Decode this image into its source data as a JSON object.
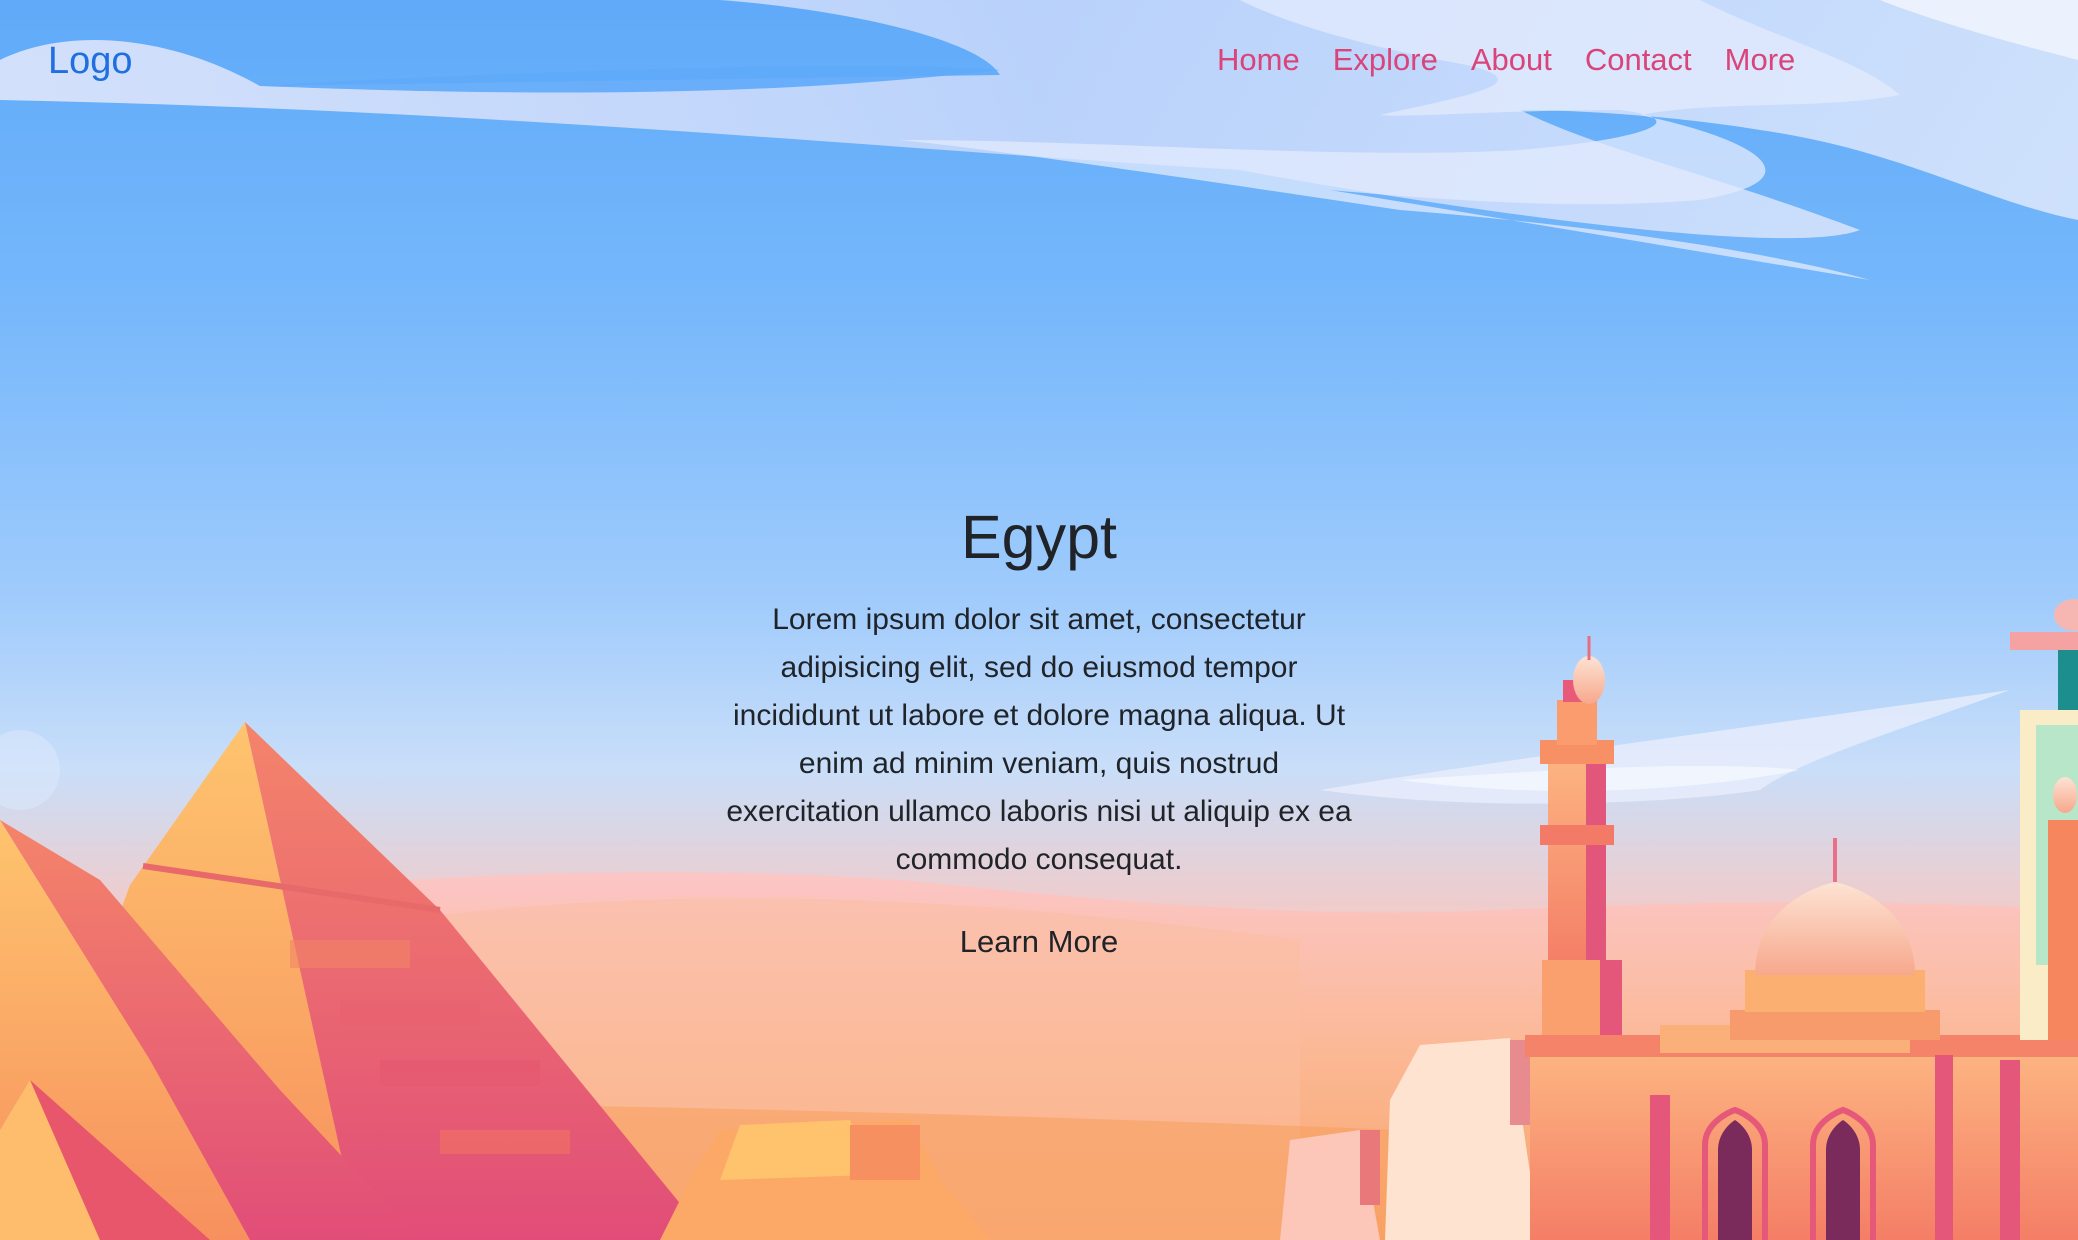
{
  "navbar": {
    "logo": "Logo",
    "links": [
      "Home",
      "Explore",
      "About",
      "Contact",
      "More"
    ]
  },
  "hero": {
    "title": "Egypt",
    "text": "Lorem ipsum dolor sit amet, consectetur adipisicing elit, sed do eiusmod tempor incididunt ut labore et dolore magna aliqua. Ut enim ad minim veniam, quis nostrud exercitation ullamco laboris nisi ut aliquip ex ea commodo consequat.",
    "button": "Learn More"
  },
  "colors": {
    "logo": "#1f6fe0",
    "nav_link": "#d9457a",
    "text": "#202428",
    "sky_top": "#5faaf9",
    "sand": "#f7a36a"
  }
}
